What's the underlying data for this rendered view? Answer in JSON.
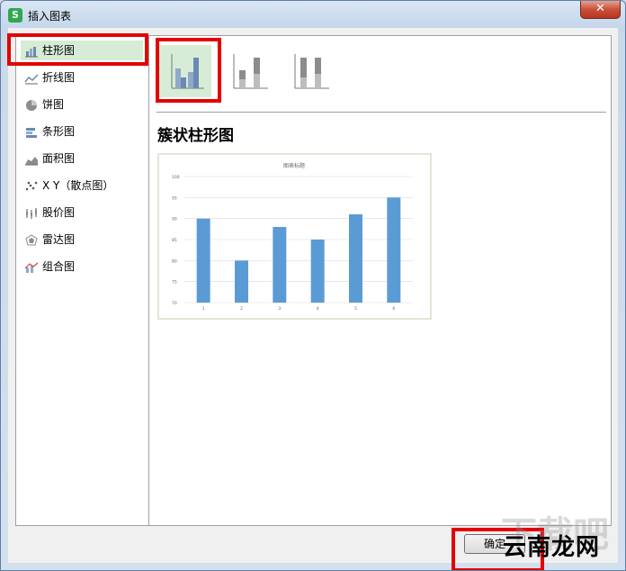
{
  "window": {
    "title": "插入图表",
    "app_icon": "S",
    "close_symbol": "✕"
  },
  "categories": [
    {
      "label": "柱形图",
      "icon": "column-chart-icon",
      "selected": true
    },
    {
      "label": "折线图",
      "icon": "line-chart-icon"
    },
    {
      "label": "饼图",
      "icon": "pie-chart-icon"
    },
    {
      "label": "条形图",
      "icon": "bar-chart-icon"
    },
    {
      "label": "面积图",
      "icon": "area-chart-icon"
    },
    {
      "label": "X Y（散点图）",
      "icon": "scatter-chart-icon"
    },
    {
      "label": "股价图",
      "icon": "stock-chart-icon"
    },
    {
      "label": "雷达图",
      "icon": "radar-chart-icon"
    },
    {
      "label": "组合图",
      "icon": "combo-chart-icon"
    }
  ],
  "subtypes": [
    {
      "icon": "clustered-column-icon",
      "selected": true
    },
    {
      "icon": "stacked-column-icon"
    },
    {
      "icon": "percent-stacked-column-icon"
    }
  ],
  "subtype_title": "簇状柱形图",
  "chart_data": {
    "type": "bar",
    "title": "图表标题",
    "categories": [
      "1",
      "2",
      "3",
      "4",
      "5",
      "6"
    ],
    "values": [
      90,
      80,
      88,
      85,
      91,
      95
    ],
    "ylim": [
      70,
      100
    ],
    "yticks": [
      "100",
      "95",
      "90",
      "85",
      "80",
      "75",
      "70"
    ],
    "bar_color": "#5b9bd5",
    "grid": true
  },
  "buttons": {
    "ok": "确定"
  },
  "watermark": {
    "text": "云南龙网",
    "ghost": "下载吧"
  },
  "colors": {
    "highlight_red": "#e40000",
    "selected_bg": "#d7ecd6"
  }
}
